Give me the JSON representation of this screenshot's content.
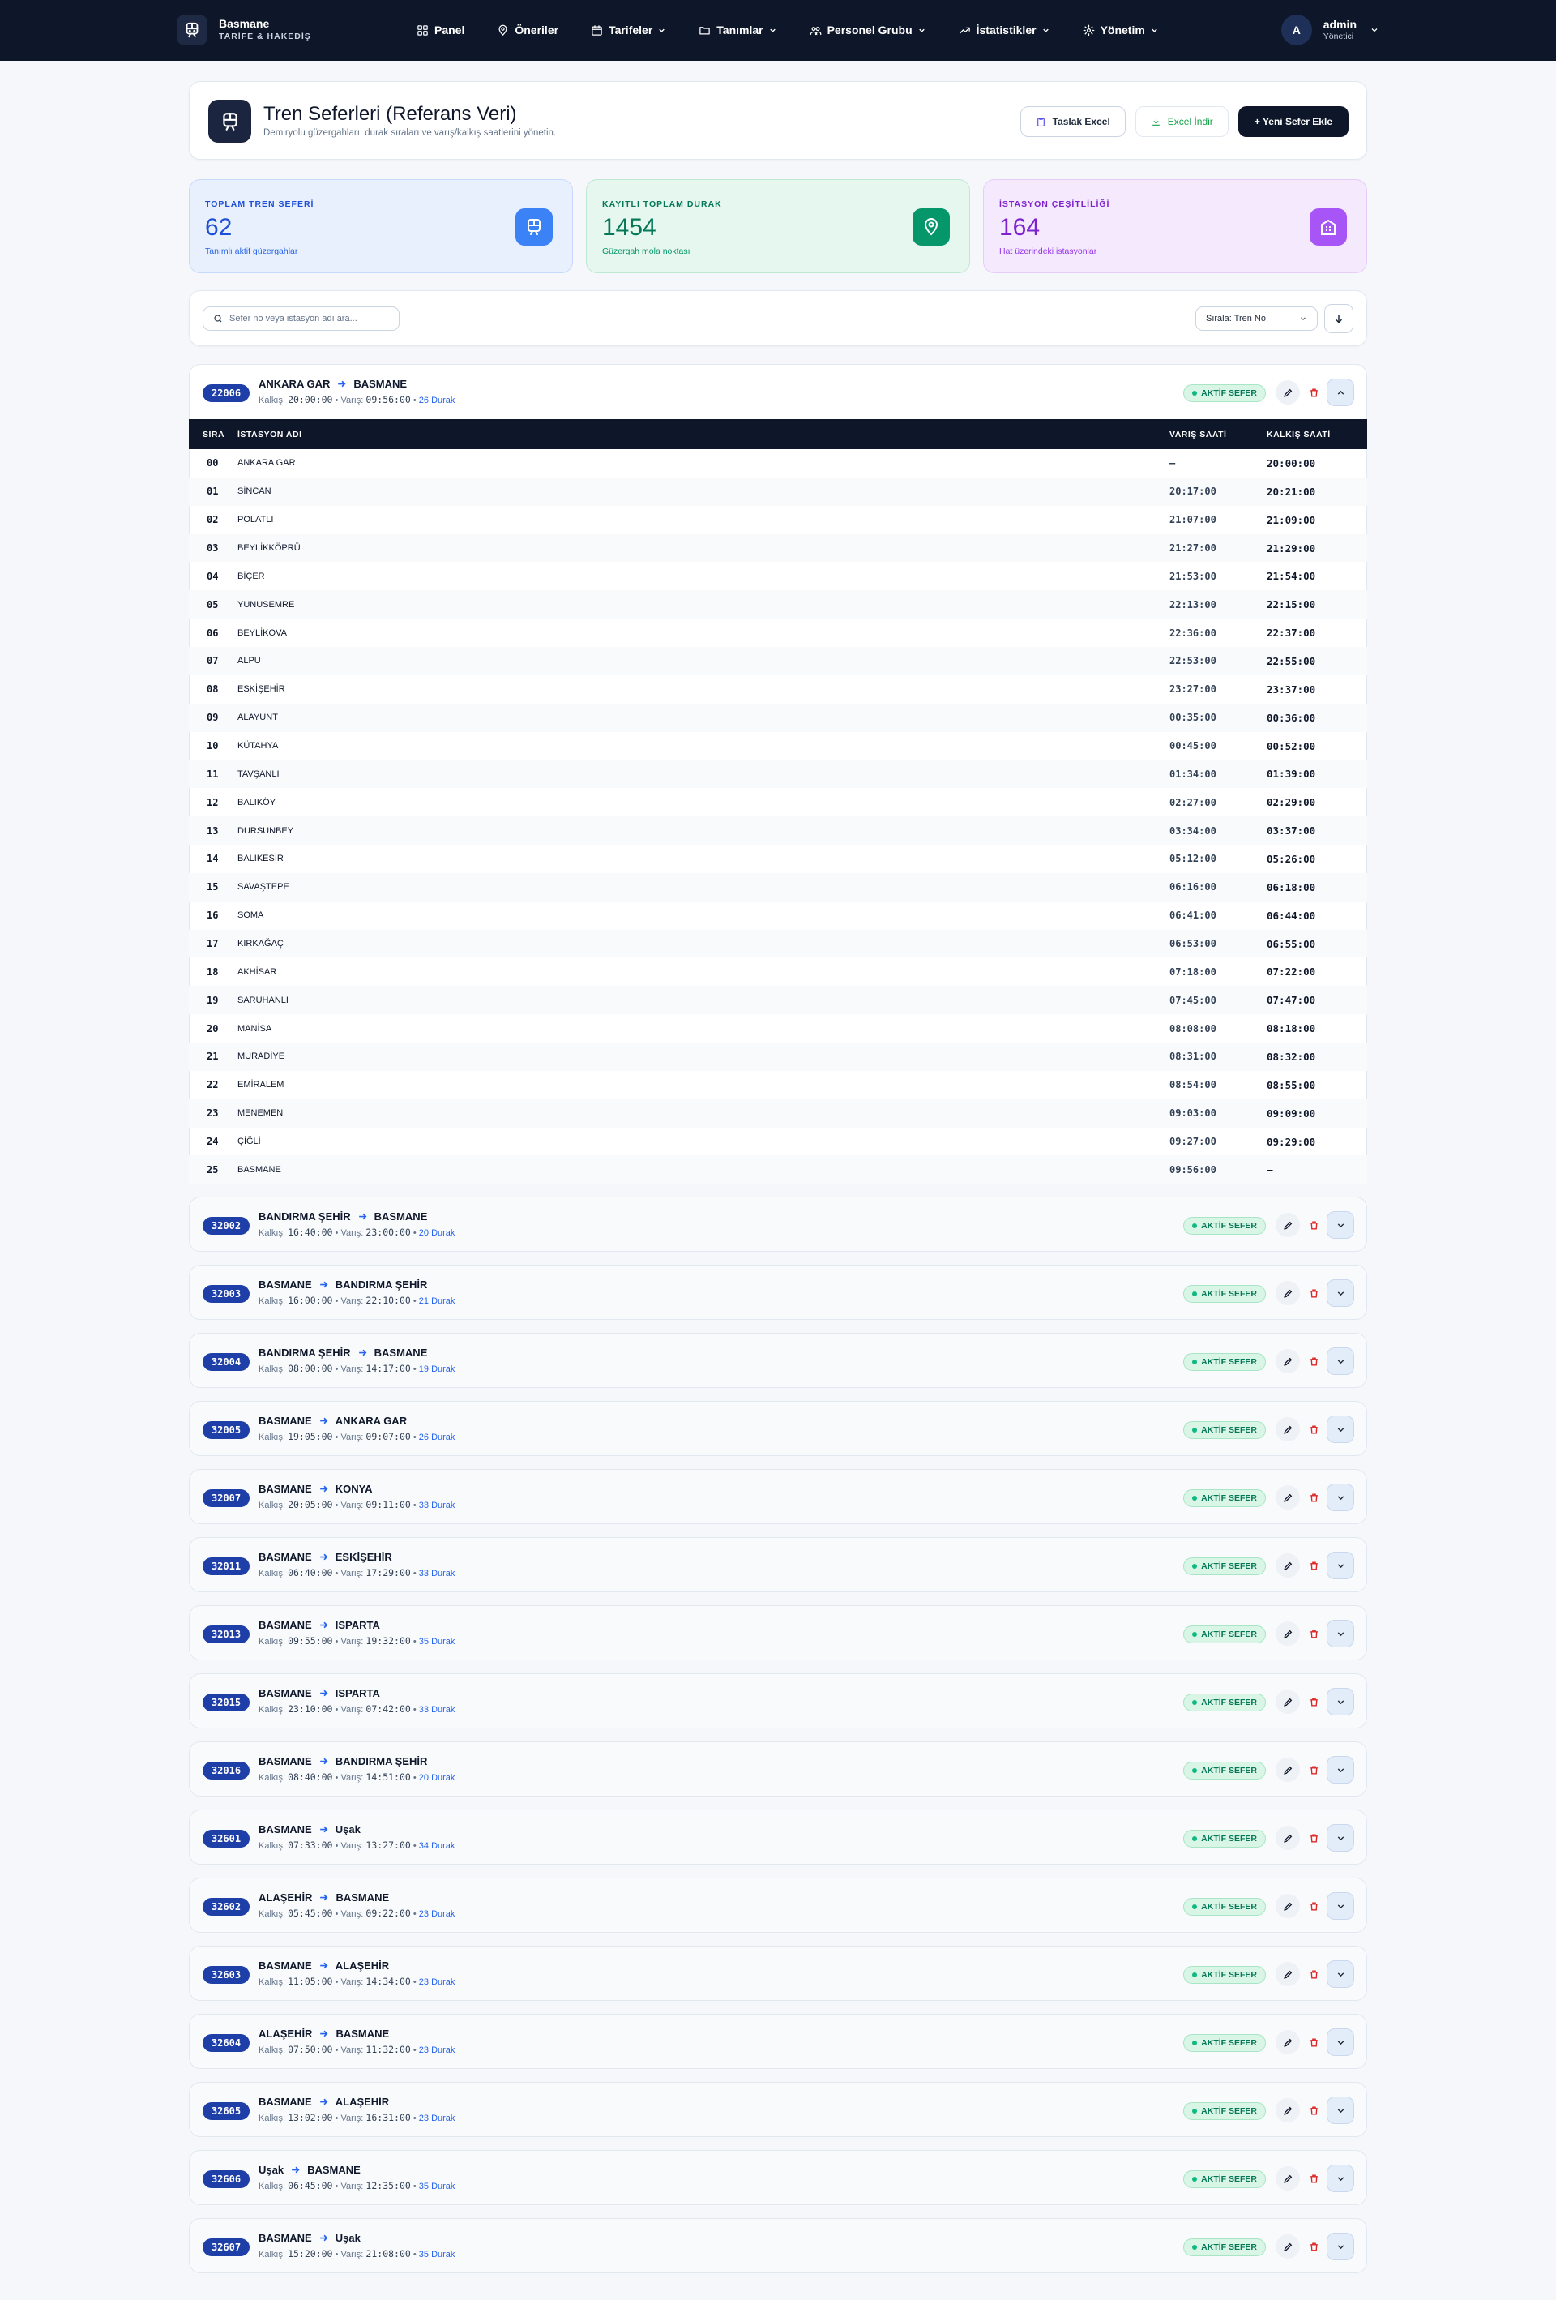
{
  "nav": {
    "brand_name": "Basmane",
    "brand_sub": "TARİFE & HAKEDİŞ",
    "items": [
      {
        "label": "Panel",
        "icon": "dashboard-icon",
        "dropdown": false
      },
      {
        "label": "Öneriler",
        "icon": "lightbulb-icon",
        "dropdown": false
      },
      {
        "label": "Tarifeler",
        "icon": "calendar-icon",
        "dropdown": true
      },
      {
        "label": "Tanımlar",
        "icon": "folder-icon",
        "dropdown": true
      },
      {
        "label": "Personel Grubu",
        "icon": "users-icon",
        "dropdown": true
      },
      {
        "label": "İstatistikler",
        "icon": "trending-icon",
        "dropdown": true
      },
      {
        "label": "Yönetim",
        "icon": "settings-icon",
        "dropdown": true
      }
    ],
    "user": {
      "initial": "A",
      "name": "admin",
      "role": "Yönetici"
    }
  },
  "page": {
    "title": "Tren Seferleri (Referans Veri)",
    "subtitle": "Demiryolu güzergahları, durak sıraları ve varış/kalkış saatlerini yönetin.",
    "buttons": {
      "template": "Taslak Excel",
      "export": "Excel İndir",
      "add": "+ Yeni Sefer Ekle"
    }
  },
  "stats": [
    {
      "label": "TOPLAM TREN SEFERİ",
      "value": "62",
      "sub": "Tanımlı aktif güzergahlar",
      "color": "#2563eb"
    },
    {
      "label": "KAYITLI TOPLAM DURAK",
      "value": "1454",
      "sub": "Güzergah mola noktası",
      "color": "#059669"
    },
    {
      "label": "İSTASYON ÇEŞİTLİLİĞİ",
      "value": "164",
      "sub": "Hat üzerindeki istasyonlar",
      "color": "#9333ea"
    }
  ],
  "filters": {
    "search_placeholder": "Sefer no veya istasyon adı ara...",
    "sort_label": "Sırala: Tren No"
  },
  "labels": {
    "departure": "Kalkış:",
    "arrival": "Varış:",
    "stops_suffix": "Durak",
    "active": "AKTİF SEFER"
  },
  "table_headers": {
    "order": "SIRA",
    "station": "İSTASYON ADI",
    "arrival": "VARIŞ SAATİ",
    "departure": "KALKIŞ SAATİ"
  },
  "expanded_train": {
    "no": "22006",
    "from": "ANKARA GAR",
    "to": "BASMANE",
    "dep": "20:00:00",
    "arr": "09:56:00",
    "stops": "26 Durak",
    "rows": [
      {
        "seq": "00",
        "station": "ANKARA GAR",
        "arr": "—",
        "dep": "20:00:00"
      },
      {
        "seq": "01",
        "station": "SİNCAN",
        "arr": "20:17:00",
        "dep": "20:21:00"
      },
      {
        "seq": "02",
        "station": "POLATLI",
        "arr": "21:07:00",
        "dep": "21:09:00"
      },
      {
        "seq": "03",
        "station": "BEYLİKKÖPRÜ",
        "arr": "21:27:00",
        "dep": "21:29:00"
      },
      {
        "seq": "04",
        "station": "BİÇER",
        "arr": "21:53:00",
        "dep": "21:54:00"
      },
      {
        "seq": "05",
        "station": "YUNUSEMRE",
        "arr": "22:13:00",
        "dep": "22:15:00"
      },
      {
        "seq": "06",
        "station": "BEYLİKOVA",
        "arr": "22:36:00",
        "dep": "22:37:00"
      },
      {
        "seq": "07",
        "station": "ALPU",
        "arr": "22:53:00",
        "dep": "22:55:00"
      },
      {
        "seq": "08",
        "station": "ESKİŞEHİR",
        "arr": "23:27:00",
        "dep": "23:37:00"
      },
      {
        "seq": "09",
        "station": "ALAYUNT",
        "arr": "00:35:00",
        "dep": "00:36:00"
      },
      {
        "seq": "10",
        "station": "KÜTAHYA",
        "arr": "00:45:00",
        "dep": "00:52:00"
      },
      {
        "seq": "11",
        "station": "TAVŞANLI",
        "arr": "01:34:00",
        "dep": "01:39:00"
      },
      {
        "seq": "12",
        "station": "BALIKÖY",
        "arr": "02:27:00",
        "dep": "02:29:00"
      },
      {
        "seq": "13",
        "station": "DURSUNBEY",
        "arr": "03:34:00",
        "dep": "03:37:00"
      },
      {
        "seq": "14",
        "station": "BALIKESİR",
        "arr": "05:12:00",
        "dep": "05:26:00"
      },
      {
        "seq": "15",
        "station": "SAVAŞTEPE",
        "arr": "06:16:00",
        "dep": "06:18:00"
      },
      {
        "seq": "16",
        "station": "SOMA",
        "arr": "06:41:00",
        "dep": "06:44:00"
      },
      {
        "seq": "17",
        "station": "KIRKAĞAÇ",
        "arr": "06:53:00",
        "dep": "06:55:00"
      },
      {
        "seq": "18",
        "station": "AKHİSAR",
        "arr": "07:18:00",
        "dep": "07:22:00"
      },
      {
        "seq": "19",
        "station": "SARUHANLI",
        "arr": "07:45:00",
        "dep": "07:47:00"
      },
      {
        "seq": "20",
        "station": "MANİSA",
        "arr": "08:08:00",
        "dep": "08:18:00"
      },
      {
        "seq": "21",
        "station": "MURADİYE",
        "arr": "08:31:00",
        "dep": "08:32:00"
      },
      {
        "seq": "22",
        "station": "EMİRALEM",
        "arr": "08:54:00",
        "dep": "08:55:00"
      },
      {
        "seq": "23",
        "station": "MENEMEN",
        "arr": "09:03:00",
        "dep": "09:09:00"
      },
      {
        "seq": "24",
        "station": "ÇİĞLİ",
        "arr": "09:27:00",
        "dep": "09:29:00"
      },
      {
        "seq": "25",
        "station": "BASMANE",
        "arr": "09:56:00",
        "dep": "—"
      }
    ]
  },
  "trains": [
    {
      "no": "32002",
      "from": "BANDIRMA ŞEHİR",
      "to": "BASMANE",
      "dep": "16:40:00",
      "arr": "23:00:00",
      "stops": "20 Durak"
    },
    {
      "no": "32003",
      "from": "BASMANE",
      "to": "BANDIRMA ŞEHİR",
      "dep": "16:00:00",
      "arr": "22:10:00",
      "stops": "21 Durak"
    },
    {
      "no": "32004",
      "from": "BANDIRMA ŞEHİR",
      "to": "BASMANE",
      "dep": "08:00:00",
      "arr": "14:17:00",
      "stops": "19 Durak"
    },
    {
      "no": "32005",
      "from": "BASMANE",
      "to": "ANKARA GAR",
      "dep": "19:05:00",
      "arr": "09:07:00",
      "stops": "26 Durak"
    },
    {
      "no": "32007",
      "from": "BASMANE",
      "to": "KONYA",
      "dep": "20:05:00",
      "arr": "09:11:00",
      "stops": "33 Durak"
    },
    {
      "no": "32011",
      "from": "BASMANE",
      "to": "ESKİŞEHİR",
      "dep": "06:40:00",
      "arr": "17:29:00",
      "stops": "33 Durak"
    },
    {
      "no": "32013",
      "from": "BASMANE",
      "to": "ISPARTA",
      "dep": "09:55:00",
      "arr": "19:32:00",
      "stops": "35 Durak"
    },
    {
      "no": "32015",
      "from": "BASMANE",
      "to": "ISPARTA",
      "dep": "23:10:00",
      "arr": "07:42:00",
      "stops": "33 Durak"
    },
    {
      "no": "32016",
      "from": "BASMANE",
      "to": "BANDIRMA ŞEHİR",
      "dep": "08:40:00",
      "arr": "14:51:00",
      "stops": "20 Durak"
    },
    {
      "no": "32601",
      "from": "BASMANE",
      "to": "Uşak",
      "dep": "07:33:00",
      "arr": "13:27:00",
      "stops": "34 Durak"
    },
    {
      "no": "32602",
      "from": "ALAŞEHİR",
      "to": "BASMANE",
      "dep": "05:45:00",
      "arr": "09:22:00",
      "stops": "23 Durak"
    },
    {
      "no": "32603",
      "from": "BASMANE",
      "to": "ALAŞEHİR",
      "dep": "11:05:00",
      "arr": "14:34:00",
      "stops": "23 Durak"
    },
    {
      "no": "32604",
      "from": "ALAŞEHİR",
      "to": "BASMANE",
      "dep": "07:50:00",
      "arr": "11:32:00",
      "stops": "23 Durak"
    },
    {
      "no": "32605",
      "from": "BASMANE",
      "to": "ALAŞEHİR",
      "dep": "13:02:00",
      "arr": "16:31:00",
      "stops": "23 Durak"
    },
    {
      "no": "32606",
      "from": "Uşak",
      "to": "BASMANE",
      "dep": "06:45:00",
      "arr": "12:35:00",
      "stops": "35 Durak"
    },
    {
      "no": "32607",
      "from": "BASMANE",
      "to": "Uşak",
      "dep": "15:20:00",
      "arr": "21:08:00",
      "stops": "35 Durak"
    }
  ]
}
